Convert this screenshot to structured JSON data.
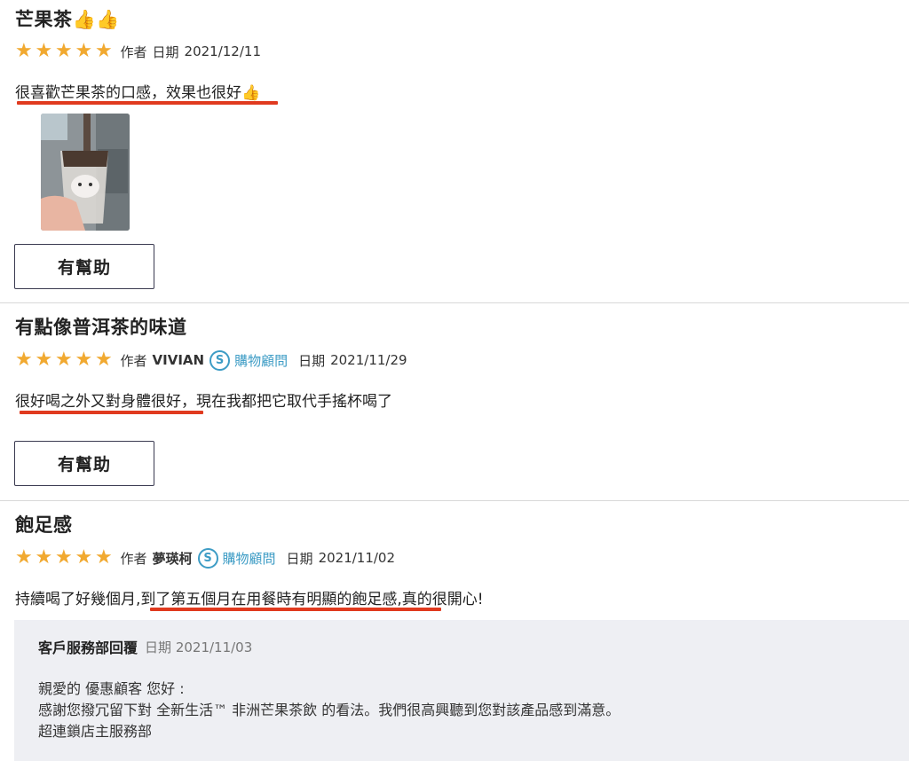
{
  "reviews": [
    {
      "title": "芒果茶👍👍",
      "rating": 5,
      "author_label": "作者",
      "date_label": "日期",
      "date": "2021/12/11",
      "body": "很喜歡芒果茶的口感，效果也很好👍",
      "helpful_label": "有幫助"
    },
    {
      "title": "有點像普洱茶的味道",
      "rating": 5,
      "author_label": "作者",
      "author": "VIVIAN",
      "badge_letter": "S",
      "badge_label": "購物顧問",
      "date_label": "日期",
      "date": "2021/11/29",
      "body": "很好喝之外又對身體很好，現在我都把它取代手搖杯喝了",
      "helpful_label": "有幫助"
    },
    {
      "title": "飽足感",
      "rating": 5,
      "author_label": "作者",
      "author": "夢瑛柯",
      "badge_letter": "S",
      "badge_label": "購物顧問",
      "date_label": "日期",
      "date": "2021/11/02",
      "body": "持續喝了好幾個月,到了第五個月在用餐時有明顯的飽足感,真的很開心!",
      "reply": {
        "title": "客戶服務部回覆",
        "date_label": "日期",
        "date": "2021/11/03",
        "lines": [
          "親愛的 優惠顧客 您好 :",
          "感謝您撥冗留下對 全新生活™ 非洲芒果茶飲 的看法。我們很高興聽到您對該產品感到滿意。",
          "超連鎖店主服務部"
        ]
      }
    }
  ],
  "colors": {
    "star": "#f1a930",
    "badge": "#3d9cc5",
    "underline": "#e03a1f",
    "reply_bg": "#eeeff3",
    "button_border": "#3a3a50"
  },
  "icons": {
    "star": "star-icon",
    "badge": "shopper-badge-icon",
    "thumbs_up": "thumbs-up-icon"
  }
}
